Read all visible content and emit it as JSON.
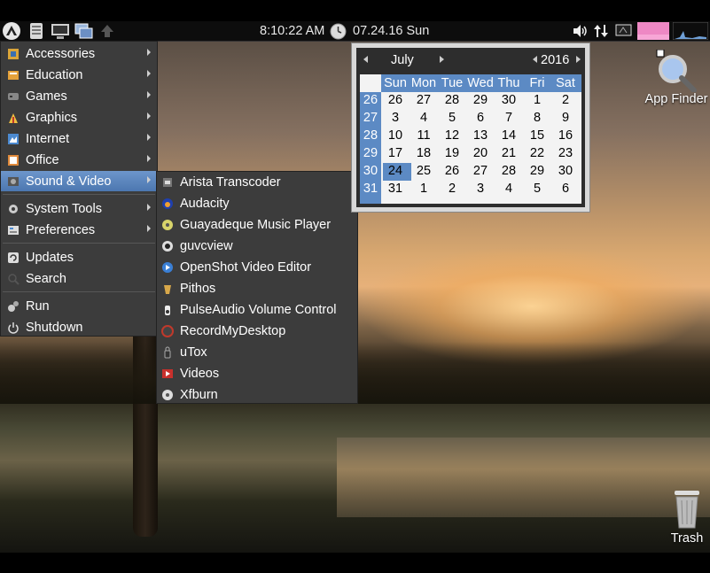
{
  "panel": {
    "clock": "8:10:22 AM",
    "date": "07.24.16 Sun",
    "launchers": [
      "start-menu-icon",
      "file-manager-icon",
      "terminal-icon",
      "show-desktop-icon",
      "update-arrow-icon"
    ],
    "tray_icons": [
      "volume-icon",
      "network-icon",
      "battery-icon",
      "cpu-monitor-icon",
      "network-monitor-icon"
    ]
  },
  "menu": {
    "items": [
      {
        "label": "Accessories",
        "icon": "accessories-icon",
        "submenu": true
      },
      {
        "label": "Education",
        "icon": "education-icon",
        "submenu": true
      },
      {
        "label": "Games",
        "icon": "games-icon",
        "submenu": true
      },
      {
        "label": "Graphics",
        "icon": "graphics-icon",
        "submenu": true
      },
      {
        "label": "Internet",
        "icon": "internet-icon",
        "submenu": true
      },
      {
        "label": "Office",
        "icon": "office-icon",
        "submenu": true
      },
      {
        "label": "Sound & Video",
        "icon": "sound-video-icon",
        "submenu": true,
        "active": true
      },
      {
        "label": "System Tools",
        "icon": "system-tools-icon",
        "submenu": true
      },
      {
        "label": "Preferences",
        "icon": "preferences-icon",
        "submenu": true
      },
      {
        "label": "Updates",
        "icon": "updates-icon",
        "submenu": false
      },
      {
        "label": "Search",
        "icon": "search-icon",
        "submenu": false
      },
      {
        "label": "Run",
        "icon": "run-icon",
        "submenu": false
      },
      {
        "label": "Shutdown",
        "icon": "power-icon",
        "submenu": false
      }
    ]
  },
  "submenu": {
    "items": [
      {
        "label": "Arista Transcoder",
        "icon": "arista-icon"
      },
      {
        "label": "Audacity",
        "icon": "audacity-icon"
      },
      {
        "label": "Guayadeque Music Player",
        "icon": "guayadeque-icon"
      },
      {
        "label": "guvcview",
        "icon": "guvcview-icon"
      },
      {
        "label": "OpenShot Video Editor",
        "icon": "openshot-icon"
      },
      {
        "label": "Pithos",
        "icon": "pithos-icon"
      },
      {
        "label": "PulseAudio Volume Control",
        "icon": "pulseaudio-icon"
      },
      {
        "label": "RecordMyDesktop",
        "icon": "recordmydesktop-icon"
      },
      {
        "label": "uTox",
        "icon": "utox-icon"
      },
      {
        "label": "Videos",
        "icon": "videos-icon"
      },
      {
        "label": "Xfburn",
        "icon": "xfburn-icon"
      }
    ]
  },
  "calendar": {
    "month": "July",
    "year": "2016",
    "weekdays": [
      "Sun",
      "Mon",
      "Tue",
      "Wed",
      "Thu",
      "Fri",
      "Sat"
    ],
    "weeks": [
      "26",
      "27",
      "28",
      "29",
      "30",
      "31"
    ],
    "days": [
      [
        "26",
        "27",
        "28",
        "29",
        "30",
        "1",
        "2"
      ],
      [
        "3",
        "4",
        "5",
        "6",
        "7",
        "8",
        "9"
      ],
      [
        "10",
        "11",
        "12",
        "13",
        "14",
        "15",
        "16"
      ],
      [
        "17",
        "18",
        "19",
        "20",
        "21",
        "22",
        "23"
      ],
      [
        "24",
        "25",
        "26",
        "27",
        "28",
        "29",
        "30"
      ],
      [
        "31",
        "1",
        "2",
        "3",
        "4",
        "5",
        "6"
      ]
    ],
    "selected_day": "24"
  },
  "desktop_icons": {
    "app_finder": "App Finder",
    "trash": "Trash"
  },
  "colors": {
    "menu_bg": "#3c3c3c",
    "highlight": "#5c8ac4",
    "panel_bg": "#0d0d0d"
  }
}
